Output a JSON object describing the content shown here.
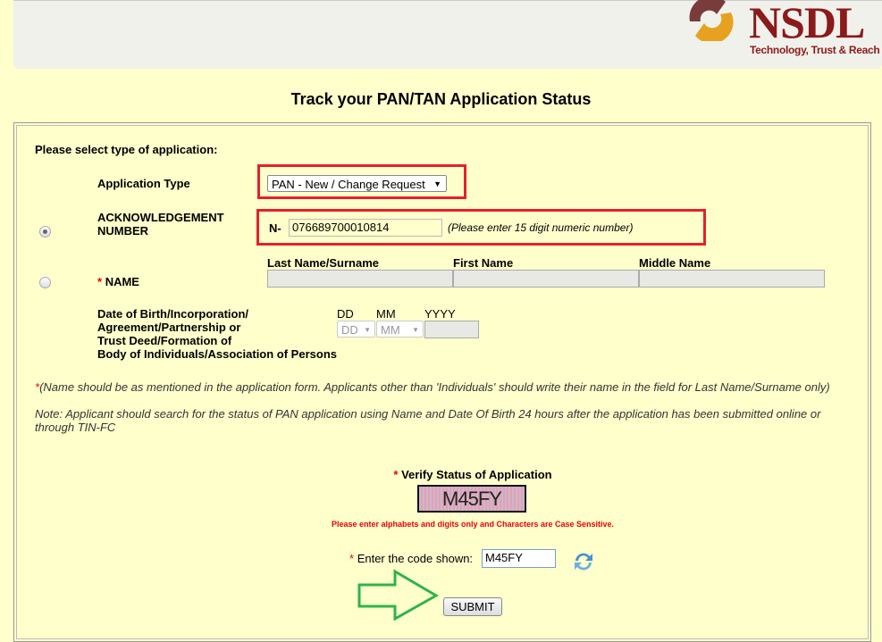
{
  "header": {
    "brand": "NSDL",
    "tagline": "Technology, Trust & Reach",
    "brand_color": "#8b1a1a"
  },
  "page_title": "Track your PAN/TAN Application Status",
  "form": {
    "select_type_label": "Please select type of application:",
    "application_type_label": "Application Type",
    "application_type_value": "PAN - New / Change Request",
    "ack_label_1": "ACKNOWLEDGEMENT",
    "ack_label_2": "NUMBER",
    "ack_prefix": "N-",
    "ack_value": "076689700010814",
    "ack_hint": "(Please enter 15 digit numeric number)",
    "ack_selected": true,
    "required_mark": "*",
    "name_label": "NAME",
    "last_name_label": "Last Name/Surname",
    "first_name_label": "First Name",
    "middle_name_label": "Middle Name",
    "dob_label_lines": [
      "Date of Birth/Incorporation/",
      "Agreement/Partnership or",
      "Trust Deed/Formation of",
      "Body of Individuals/Association of Persons"
    ],
    "dd_label": "DD",
    "mm_label": "MM",
    "yyyy_label": "YYYY",
    "dd_value": "DD",
    "mm_value": "MM",
    "name_note": "(Name should be as mentioned in the application form. Applicants other than 'Individuals' should write their name in the field for Last Name/Surname only)",
    "status_note": "Note: Applicant should search for the status of PAN application using Name and Date Of Birth 24 hours after the application has been submitted online or through TIN-FC",
    "verify_label": "Verify Status of Application",
    "captcha_text": "M45FY",
    "captcha_hint": "Please enter alphabets and digits only and Characters are Case Sensitive.",
    "code_label": "Enter the code shown:",
    "code_value": "M45FY",
    "submit_label": "SUBMIT"
  },
  "colors": {
    "background": "#ffffcc",
    "highlight": "#e4212b",
    "arrow": "#2db34a"
  }
}
